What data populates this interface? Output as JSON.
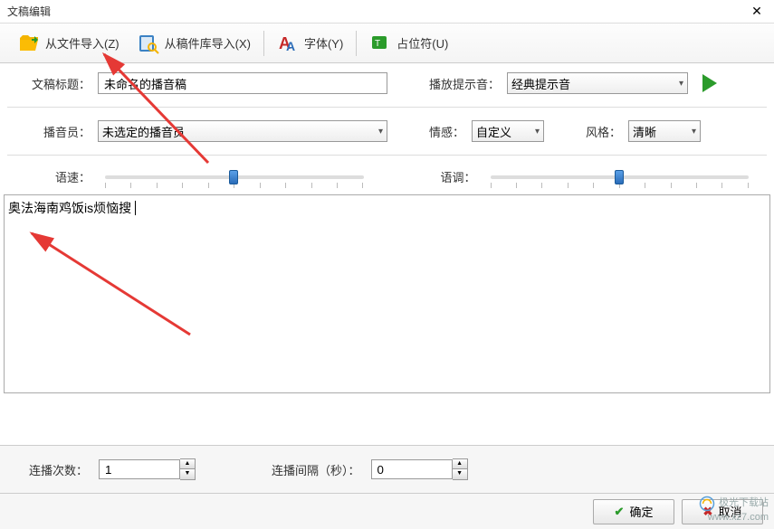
{
  "window": {
    "title": "文稿编辑"
  },
  "toolbar": {
    "import_file": "从文件导入(Z)",
    "import_lib": "从稿件库导入(X)",
    "font": "字体(Y)",
    "placeholder": "占位符(U)"
  },
  "form": {
    "title_label": "文稿标题：",
    "title_value": "未命名的播音稿",
    "sound_label": "播放提示音：",
    "sound_value": "经典提示音",
    "announcer_label": "播音员：",
    "announcer_value": "未选定的播音员",
    "emotion_label": "情感：",
    "emotion_value": "自定义",
    "style_label": "风格：",
    "style_value": "清晰",
    "speed_label": "语速：",
    "tone_label": "语调："
  },
  "content": {
    "text": "奥法海南鸡饭is烦恼搜"
  },
  "bottom": {
    "repeat_label": "连播次数：",
    "repeat_value": "1",
    "gap_label": "连播间隔（秒）：",
    "gap_value": "0"
  },
  "actions": {
    "ok": "确定",
    "cancel": "取消"
  },
  "watermark": {
    "name": "极光下载站",
    "url": "www.xz7.com"
  }
}
